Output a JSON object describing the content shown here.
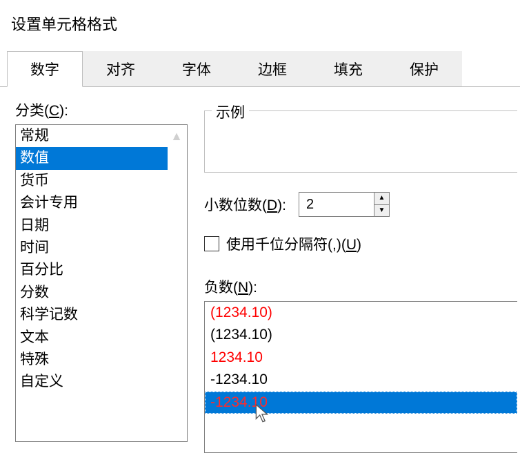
{
  "dialog": {
    "title": "设置单元格格式"
  },
  "tabs": [
    {
      "label": "数字",
      "active": true
    },
    {
      "label": "对齐",
      "active": false
    },
    {
      "label": "字体",
      "active": false
    },
    {
      "label": "边框",
      "active": false
    },
    {
      "label": "填充",
      "active": false
    },
    {
      "label": "保护",
      "active": false
    }
  ],
  "category": {
    "label_prefix": "分类(",
    "label_key": "C",
    "label_suffix": "):",
    "items": [
      {
        "label": "常规",
        "selected": false
      },
      {
        "label": "数值",
        "selected": true
      },
      {
        "label": "货币",
        "selected": false
      },
      {
        "label": "会计专用",
        "selected": false
      },
      {
        "label": "日期",
        "selected": false
      },
      {
        "label": "时间",
        "selected": false
      },
      {
        "label": "百分比",
        "selected": false
      },
      {
        "label": "分数",
        "selected": false
      },
      {
        "label": "科学记数",
        "selected": false
      },
      {
        "label": "文本",
        "selected": false
      },
      {
        "label": "特殊",
        "selected": false
      },
      {
        "label": "自定义",
        "selected": false
      }
    ]
  },
  "example": {
    "label": "示例",
    "value": ""
  },
  "decimal": {
    "label_prefix": "小数位数(",
    "label_key": "D",
    "label_suffix": "):",
    "value": "2"
  },
  "separator": {
    "checked": false,
    "label_prefix": "使用千位分隔符(,)(",
    "label_key": "U",
    "label_suffix": ")"
  },
  "negative": {
    "label_prefix": "负数(",
    "label_key": "N",
    "label_suffix": "):",
    "items": [
      {
        "text": "(1234.10)",
        "color": "red",
        "selected": false
      },
      {
        "text": "(1234.10)",
        "color": "black",
        "selected": false
      },
      {
        "text": "1234.10",
        "color": "red",
        "selected": false
      },
      {
        "text": "-1234.10",
        "color": "black",
        "selected": false
      },
      {
        "text": "-1234.10",
        "color": "red",
        "selected": true
      }
    ]
  }
}
